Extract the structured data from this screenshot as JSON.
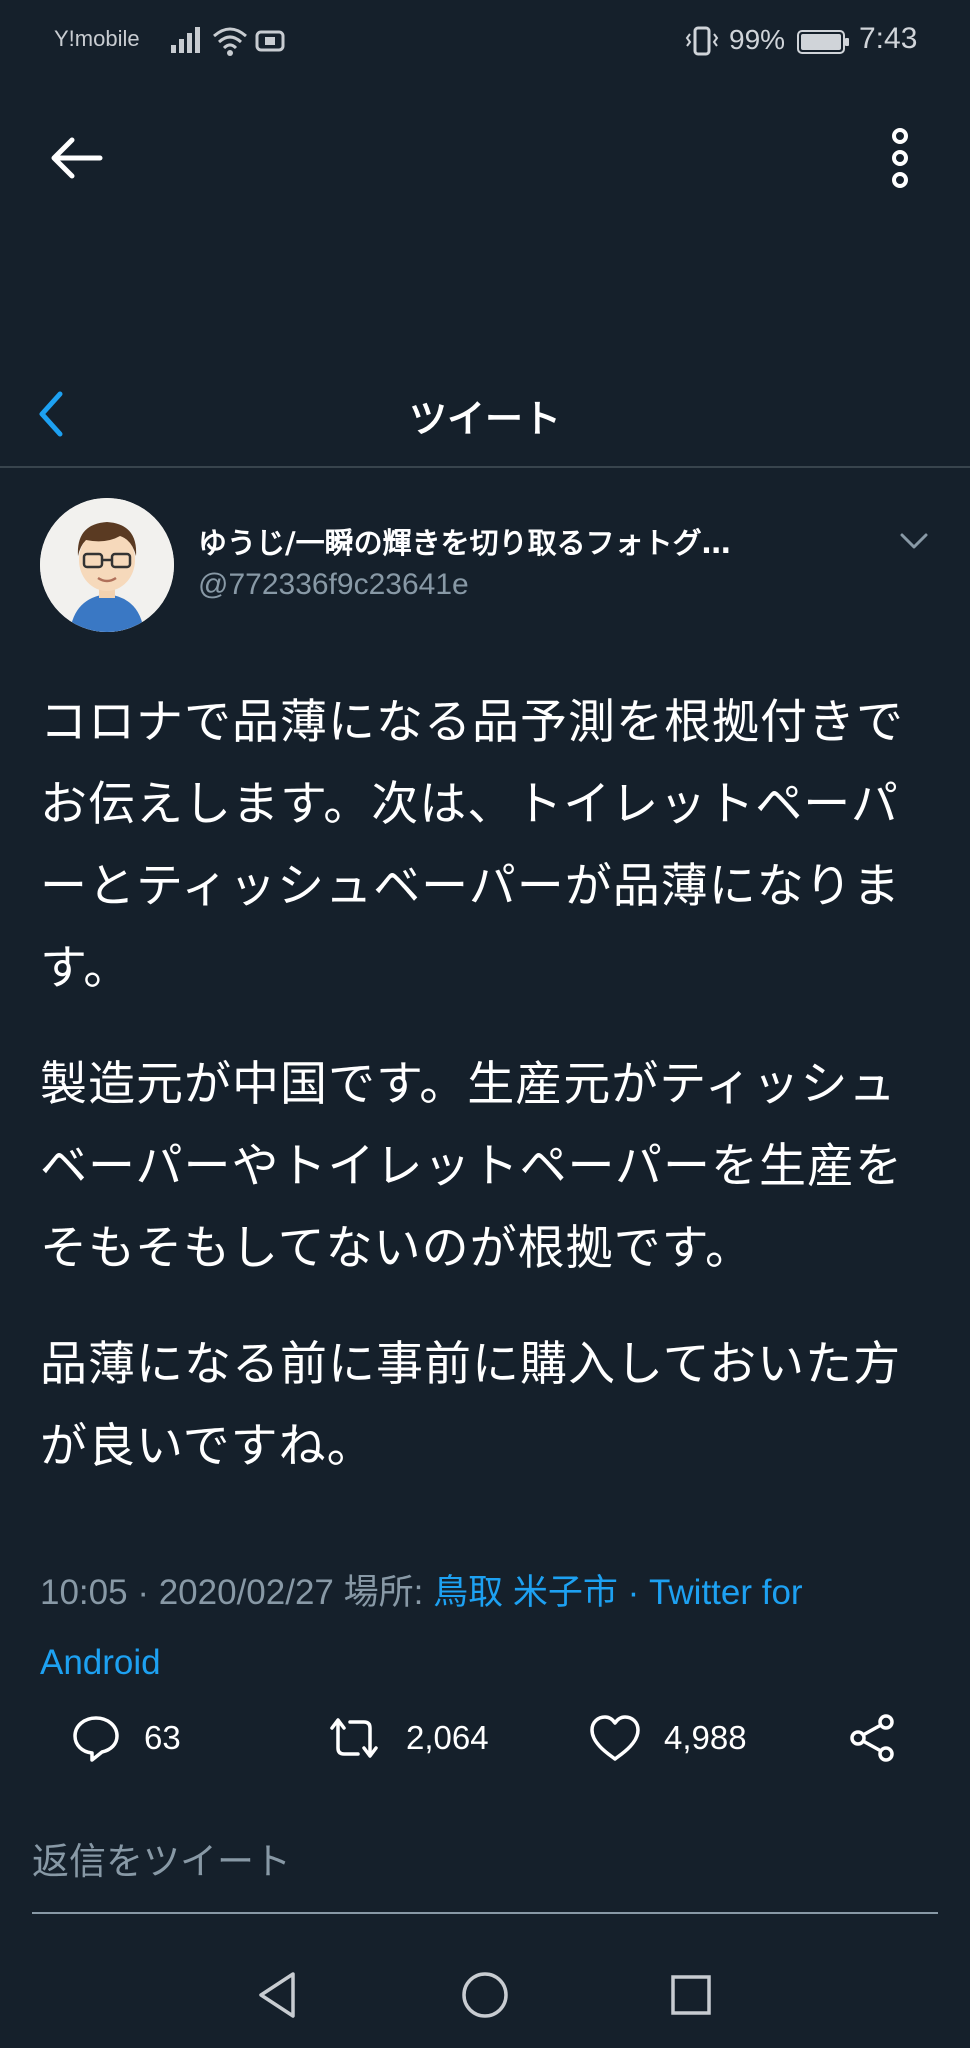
{
  "status_bar": {
    "carrier": "Y!mobile",
    "battery": "99%",
    "time": "7:43",
    "icons": [
      "signal-icon",
      "wifi-icon",
      "cast-icon",
      "vibrate-icon",
      "battery-icon"
    ]
  },
  "top_bar": {
    "icons": [
      "back-arrow-icon",
      "more-vertical-icon"
    ]
  },
  "header": {
    "title": "ツイート",
    "back_icon": "chevron-left-icon"
  },
  "tweet": {
    "author": {
      "name": "ゆうじ/一瞬の輝きを切り取るフォトグ…",
      "handle": "@772336f9c23641e"
    },
    "paragraphs": [
      "コロナで品薄になる品予測を根拠付きでお伝えします。次は、トイレットペーパーとティッシュベーパーが品薄になります。",
      "製造元が中国です。生産元がティッシュベーパーやトイレットペーパーを生産をそもそもしてないのが根拠です。",
      "品薄になる前に事前に購入しておいた方が良いですね。"
    ],
    "meta": {
      "time": "10:05",
      "date": "2020/02/27",
      "location_label": "場所:",
      "location": "鳥取 米子市",
      "source": "Twitter for Android",
      "separator": "·"
    },
    "actions": {
      "reply_count": "63",
      "retweet_count": "2,064",
      "like_count": "4,988"
    }
  },
  "reply": {
    "placeholder": "返信をツイート"
  },
  "colors": {
    "background": "#15202b",
    "accent": "#1da1f2",
    "muted": "#8899a6",
    "divider": "#38444d"
  },
  "nav_bar": {
    "icons": [
      "nav-back-icon",
      "nav-home-icon",
      "nav-recents-icon"
    ]
  }
}
